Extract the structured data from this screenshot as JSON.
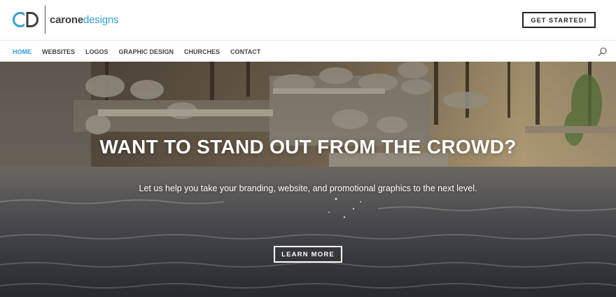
{
  "brand": {
    "logo_mark": "CD",
    "word_part1": "carone",
    "word_part2": "designs",
    "accent_color": "#2ea3d8",
    "dark_color": "#3d3d3d"
  },
  "header": {
    "cta_label": "GET STARTED!"
  },
  "nav": {
    "items": [
      {
        "label": "HOME",
        "active": true
      },
      {
        "label": "WEBSITES",
        "active": false
      },
      {
        "label": "LOGOS",
        "active": false
      },
      {
        "label": "GRAPHIC DESIGN",
        "active": false
      },
      {
        "label": "CHURCHES",
        "active": false
      },
      {
        "label": "CONTACT",
        "active": false
      }
    ],
    "search_icon": "search-icon"
  },
  "hero": {
    "title": "WANT TO STAND OUT FROM THE CROWD?",
    "subtitle": "Let us help you take your branding, website, and promotional graphics to the next level.",
    "button_label": "LEARN MORE",
    "background": "stone waterfall and pond photo"
  }
}
